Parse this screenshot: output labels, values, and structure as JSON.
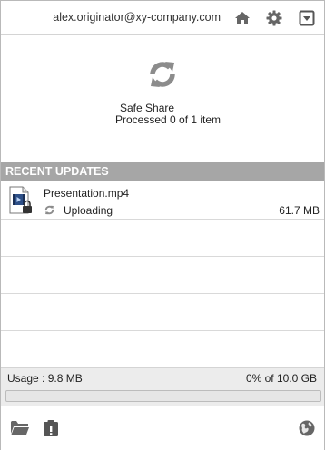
{
  "header": {
    "account": "alex.originator@xy-company.com",
    "icons": [
      "home-icon",
      "gear-icon",
      "dropdown-menu-icon"
    ]
  },
  "hero": {
    "icon": "sync-icon",
    "title": "Safe Share",
    "status": "Processed 0 of 1 item"
  },
  "recent": {
    "heading": "RECENT UPDATES",
    "items": [
      {
        "name": "Presentation.mp4",
        "status": "Uploading",
        "size": "61.7 MB",
        "icon": "video-file-icon"
      }
    ]
  },
  "usage": {
    "label": "Usage : 9.8 MB",
    "quota": "0% of 10.0 GB",
    "fraction": 0.0
  },
  "footer": {
    "icons": [
      "folder-icon",
      "clipboard-alert-icon",
      "globe-icon"
    ]
  },
  "colors": {
    "section_bar": "#a6a6a6",
    "icon_gray": "#6b6b6b",
    "sync_gray": "#8c8c8c"
  }
}
